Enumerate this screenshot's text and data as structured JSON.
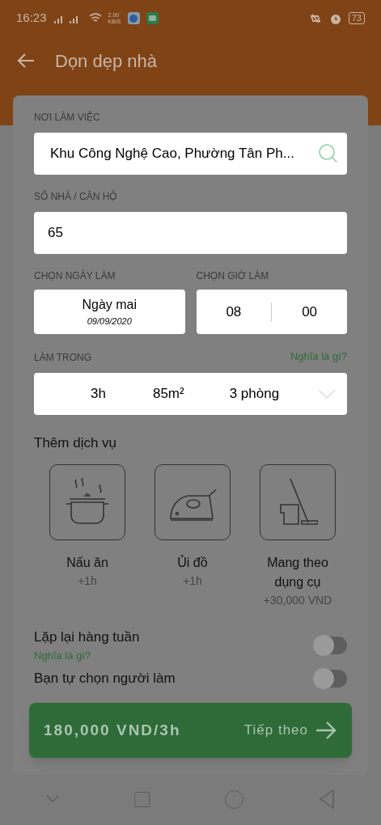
{
  "status_bar": {
    "time": "16:23",
    "net_speed": "2.00",
    "net_unit": "KB/S",
    "battery": "73"
  },
  "header": {
    "title": "Dọn dẹp nhà"
  },
  "location": {
    "label": "NƠI LÀM VIỆC",
    "value": "Khu Công Nghệ Cao, Phường Tân Ph..."
  },
  "apartment": {
    "label": "SỐ NHÀ / CĂN HỘ",
    "value": "65"
  },
  "date": {
    "label": "CHỌN NGÀY LÀM",
    "day": "Ngày mai",
    "value": "09/09/2020"
  },
  "time": {
    "label": "CHỌN GIỜ LÀM",
    "hour": "08",
    "minute": "00"
  },
  "duration": {
    "label": "LÀM TRONG",
    "help_link": "Nghĩa là gì?",
    "hours": "3h",
    "area": "85m²",
    "rooms": "3 phòng"
  },
  "extra_services": {
    "title": "Thêm dịch vụ",
    "items": [
      {
        "kind": "cooking",
        "name": "Nấu ăn",
        "extra": "+1h"
      },
      {
        "kind": "ironing",
        "name": "Ủi đồ",
        "extra": "+1h"
      },
      {
        "kind": "tools",
        "name": "Mang theo dụng cụ",
        "extra": "+30,000 VND"
      }
    ]
  },
  "options": [
    {
      "label": "Lặp lại hàng tuần",
      "help_link": "Nghĩa là gì?",
      "on": false
    },
    {
      "label": "Bạn tự chọn người làm",
      "on": false
    }
  ],
  "next_button": {
    "price": "180,000 VND/3h",
    "label": "Tiếp theo"
  }
}
